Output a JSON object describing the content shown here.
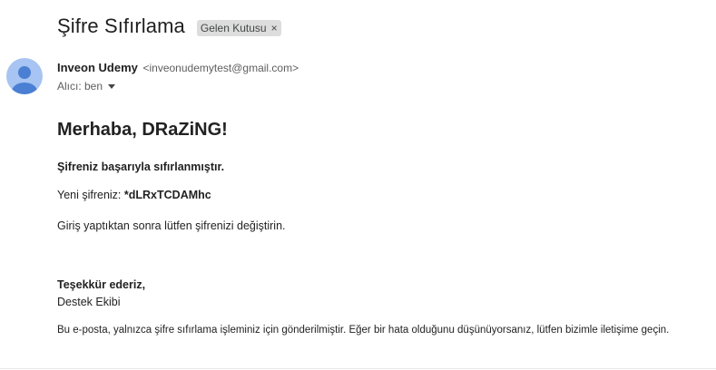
{
  "email": {
    "subject": "Şifre Sıfırlama",
    "label": "Gelen Kutusu",
    "label_remove": "×",
    "sender_name": "Inveon Udemy",
    "sender_email": "<inveonudemytest@gmail.com>",
    "recipient": "Alıcı: ben",
    "icons": {
      "avatar": "avatar-person-icon",
      "recipient_details": "caret-down-icon",
      "label_remove": "close-icon"
    },
    "colors": {
      "avatar_bg": "#a7c4f2",
      "avatar_fg": "#4a7fd4",
      "label_bg": "#dddddd"
    }
  },
  "message": {
    "greeting": "Merhaba, DRaZiNG!",
    "reset_success": "Şifreniz başarıyla sıfırlanmıştır.",
    "new_password_label": "Yeni şifreniz: ",
    "new_password_value": "*dLRxTCDAMhc",
    "change_advice": "Giriş yaptıktan sonra lütfen şifrenizi değiştirin.",
    "thanks": "Teşekkür ederiz,",
    "team": "Destek Ekibi",
    "footer": "Bu e-posta, yalnızca şifre sıfırlama işleminiz için gönderilmiştir. Eğer bir hata olduğunu düşünüyorsanız, lütfen bizimle iletişime geçin."
  }
}
